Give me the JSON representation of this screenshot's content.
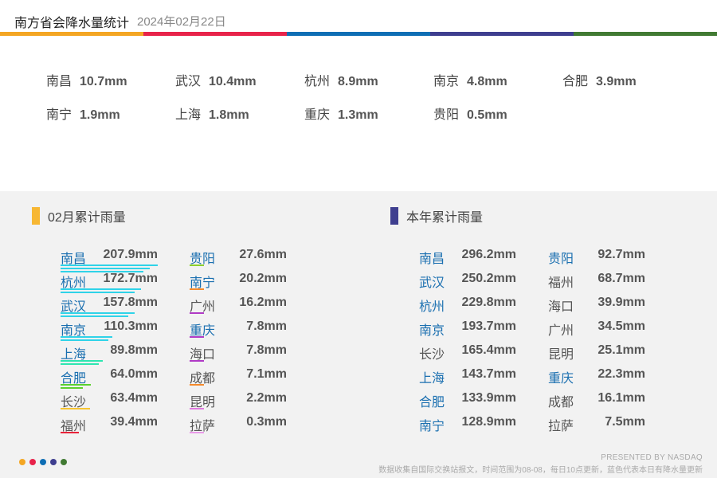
{
  "header": {
    "title": "南方省会降水量统计",
    "date": "2024年02月22日"
  },
  "colors": {
    "band": [
      "#f4a623",
      "#e8234a",
      "#0e6eb4",
      "#3e3e8f",
      "#417a33"
    ],
    "highlight_city": "#1a6fb0",
    "monthly_marker": "#f7b733",
    "yearly_marker": "#3e3e8f"
  },
  "today": [
    {
      "city": "南昌",
      "value": "10.7mm"
    },
    {
      "city": "武汉",
      "value": "10.4mm"
    },
    {
      "city": "杭州",
      "value": "8.9mm"
    },
    {
      "city": "南京",
      "value": "4.8mm"
    },
    {
      "city": "合肥",
      "value": "3.9mm"
    },
    {
      "city": "南宁",
      "value": "1.9mm"
    },
    {
      "city": "上海",
      "value": "1.8mm"
    },
    {
      "city": "重庆",
      "value": "1.3mm"
    },
    {
      "city": "贵阳",
      "value": "0.5mm"
    }
  ],
  "monthly": {
    "title": "02月累计雨量",
    "col1": [
      {
        "city": "南昌",
        "value": "207.9mm",
        "amount": 207.9,
        "updated": true,
        "bars": [
          "#2fd3e8",
          "#2fd3e8",
          "#2fd3e8"
        ]
      },
      {
        "city": "杭州",
        "value": "172.7mm",
        "amount": 172.7,
        "updated": true,
        "bars": [
          "#2fd3e8",
          "#2fd3e8"
        ]
      },
      {
        "city": "武汉",
        "value": "157.8mm",
        "amount": 157.8,
        "updated": true,
        "bars": [
          "#2fd3e8",
          "#2fd3e8"
        ]
      },
      {
        "city": "南京",
        "value": "110.3mm",
        "amount": 110.3,
        "updated": true,
        "bars": [
          "#2fd3e8",
          "#2fd3e8"
        ]
      },
      {
        "city": "上海",
        "value": "89.8mm",
        "amount": 89.8,
        "updated": true,
        "bars": [
          "#2ee6b0",
          "#2ee6b0"
        ]
      },
      {
        "city": "合肥",
        "value": "64.0mm",
        "amount": 64.0,
        "updated": true,
        "bars": [
          "#5ad12e",
          "#5ad12e"
        ]
      },
      {
        "city": "长沙",
        "value": "63.4mm",
        "amount": 63.4,
        "updated": false,
        "bars": [
          "#f7c431"
        ]
      },
      {
        "city": "福州",
        "value": "39.4mm",
        "amount": 39.4,
        "updated": false,
        "bars": [
          "#e8233a"
        ]
      }
    ],
    "col2": [
      {
        "city": "贵阳",
        "value": "27.6mm",
        "amount": 27.6,
        "updated": true,
        "bars": [
          "#8ccf2e"
        ]
      },
      {
        "city": "南宁",
        "value": "20.2mm",
        "amount": 20.2,
        "updated": true,
        "bars": [
          "#f58a2c"
        ]
      },
      {
        "city": "广州",
        "value": "16.2mm",
        "amount": 16.2,
        "updated": false,
        "bars": [
          "#b03bc6"
        ]
      },
      {
        "city": "重庆",
        "value": "7.8mm",
        "amount": 7.8,
        "updated": true,
        "bars": [
          "#b03bc6"
        ]
      },
      {
        "city": "海口",
        "value": "7.8mm",
        "amount": 7.8,
        "updated": false,
        "bars": [
          "#b03bc6"
        ]
      },
      {
        "city": "成都",
        "value": "7.1mm",
        "amount": 7.1,
        "updated": false,
        "bars": [
          "#f58a2c"
        ]
      },
      {
        "city": "昆明",
        "value": "2.2mm",
        "amount": 2.2,
        "updated": false,
        "bars": [
          "#e07ae0"
        ]
      },
      {
        "city": "拉萨",
        "value": "0.3mm",
        "amount": 0.3,
        "updated": false,
        "bars": [
          "#e89ae8"
        ]
      }
    ]
  },
  "yearly": {
    "title": "本年累计雨量",
    "col1": [
      {
        "city": "南昌",
        "value": "296.2mm",
        "updated": true
      },
      {
        "city": "武汉",
        "value": "250.2mm",
        "updated": true
      },
      {
        "city": "杭州",
        "value": "229.8mm",
        "updated": true
      },
      {
        "city": "南京",
        "value": "193.7mm",
        "updated": true
      },
      {
        "city": "长沙",
        "value": "165.4mm",
        "updated": false
      },
      {
        "city": "上海",
        "value": "143.7mm",
        "updated": true
      },
      {
        "city": "合肥",
        "value": "133.9mm",
        "updated": true
      },
      {
        "city": "南宁",
        "value": "128.9mm",
        "updated": true
      }
    ],
    "col2": [
      {
        "city": "贵阳",
        "value": "92.7mm",
        "updated": true
      },
      {
        "city": "福州",
        "value": "68.7mm",
        "updated": false
      },
      {
        "city": "海口",
        "value": "39.9mm",
        "updated": false
      },
      {
        "city": "广州",
        "value": "34.5mm",
        "updated": false
      },
      {
        "city": "昆明",
        "value": "25.1mm",
        "updated": false
      },
      {
        "city": "重庆",
        "value": "22.3mm",
        "updated": true
      },
      {
        "city": "成都",
        "value": "16.1mm",
        "updated": false
      },
      {
        "city": "拉萨",
        "value": "7.5mm",
        "updated": false
      }
    ]
  },
  "footer": {
    "presented": "PRESENTED BY NASDAQ",
    "note": "数据收集自国际交换站报文，时间范围为08-08，每日10点更新，蓝色代表本日有降水量更新",
    "dots": [
      "#f4a623",
      "#e8234a",
      "#0e6eb4",
      "#3e3e8f",
      "#417a33"
    ]
  }
}
